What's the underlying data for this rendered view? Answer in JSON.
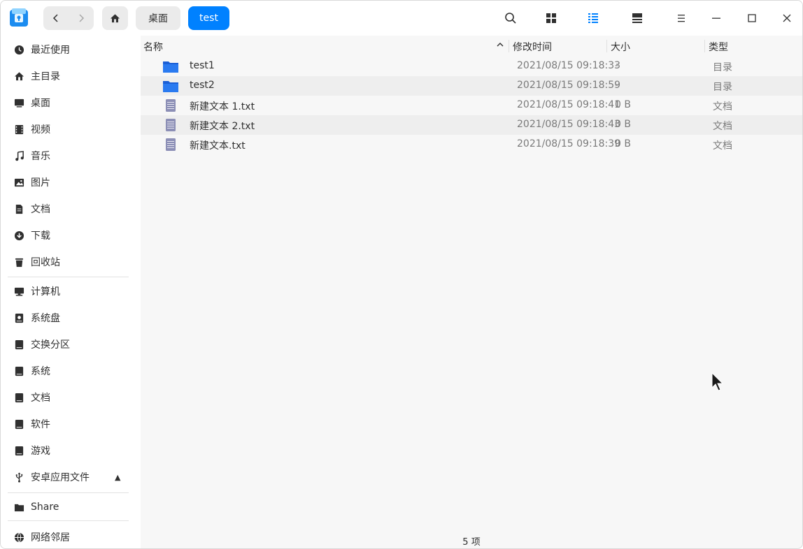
{
  "colors": {
    "accent": "#0081ff",
    "folder": "#1d6be0",
    "doc": "#8c8fb6"
  },
  "toolbar": {
    "back_icon": "chevron-left-icon",
    "forward_icon": "chevron-right-icon",
    "home_icon": "home-icon",
    "breadcrumb": [
      "桌面",
      "test"
    ],
    "icons": [
      "search-icon",
      "icon-view-icon",
      "list-view-icon",
      "detail-view-icon",
      "menu-icon",
      "minimize-icon",
      "maximize-icon",
      "close-icon"
    ]
  },
  "sidebar": {
    "items": [
      {
        "label": "最近使用",
        "icon": "clock-icon"
      },
      {
        "label": "主目录",
        "icon": "home-icon"
      },
      {
        "label": "桌面",
        "icon": "desktop-icon"
      },
      {
        "label": "视频",
        "icon": "video-icon"
      },
      {
        "label": "音乐",
        "icon": "music-icon"
      },
      {
        "label": "图片",
        "icon": "image-icon"
      },
      {
        "label": "文档",
        "icon": "document-icon"
      },
      {
        "label": "下载",
        "icon": "download-icon"
      },
      {
        "label": "回收站",
        "icon": "trash-icon"
      }
    ],
    "devices": [
      {
        "label": "计算机",
        "icon": "computer-icon"
      },
      {
        "label": "系统盘",
        "icon": "disk-icon"
      },
      {
        "label": "交换分区",
        "icon": "disk-icon"
      },
      {
        "label": "系统",
        "icon": "disk-icon"
      },
      {
        "label": "文档",
        "icon": "disk-icon"
      },
      {
        "label": "软件",
        "icon": "disk-icon"
      },
      {
        "label": "游戏",
        "icon": "disk-icon"
      },
      {
        "label": "安卓应用文件",
        "icon": "usb-icon",
        "eject": "▲"
      }
    ],
    "share": {
      "label": "Share",
      "icon": "share-folder-icon"
    },
    "network": {
      "label": "网络邻居",
      "icon": "network-icon"
    }
  },
  "table": {
    "headers": {
      "name": "名称",
      "modified": "修改时间",
      "size": "大小",
      "type": "类型"
    },
    "rows": [
      {
        "name": "test1",
        "modified": "2021/08/15 09:18:33",
        "size": "-",
        "type": "目录",
        "kind": "folder"
      },
      {
        "name": "test2",
        "modified": "2021/08/15 09:18:59",
        "size": "-",
        "type": "目录",
        "kind": "folder"
      },
      {
        "name": "新建文本 1.txt",
        "modified": "2021/08/15 09:18:41",
        "size": "0 B",
        "type": "文档",
        "kind": "doc"
      },
      {
        "name": "新建文本 2.txt",
        "modified": "2021/08/15 09:18:43",
        "size": "0 B",
        "type": "文档",
        "kind": "doc"
      },
      {
        "name": "新建文本.txt",
        "modified": "2021/08/15 09:18:39",
        "size": "0 B",
        "type": "文档",
        "kind": "doc"
      }
    ]
  },
  "status": {
    "count": "5 项"
  }
}
